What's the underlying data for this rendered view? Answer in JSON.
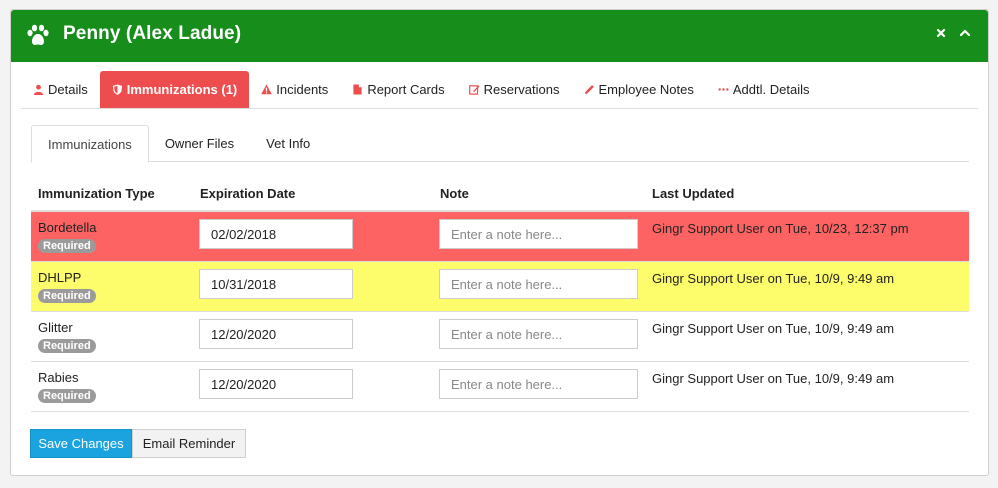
{
  "header": {
    "title": "Penny (Alex Ladue)",
    "paw_icon": "paw-icon",
    "header_bg": "#178d1b"
  },
  "main_tabs": [
    {
      "label": "Details",
      "icon": "user-icon",
      "active": false
    },
    {
      "label": "Immunizations (1)",
      "icon": "shield-icon",
      "active": true
    },
    {
      "label": "Incidents",
      "icon": "warning-icon",
      "active": false
    },
    {
      "label": "Report Cards",
      "icon": "file-icon",
      "active": false
    },
    {
      "label": "Reservations",
      "icon": "edit-icon",
      "active": false
    },
    {
      "label": "Employee Notes",
      "icon": "pencil-icon",
      "active": false
    },
    {
      "label": "Addtl. Details",
      "icon": "ellipsis-icon",
      "active": false
    }
  ],
  "sub_tabs": [
    {
      "label": "Immunizations",
      "active": true
    },
    {
      "label": "Owner Files",
      "active": false
    },
    {
      "label": "Vet Info",
      "active": false
    }
  ],
  "table": {
    "headers": [
      "Immunization Type",
      "Expiration Date",
      "Note",
      "Last Updated"
    ],
    "note_placeholder": "Enter a note here...",
    "rows": [
      {
        "type": "Bordetella",
        "badge": "Required",
        "expiration": "02/02/2018",
        "note": "",
        "last_updated": "Gingr Support User on Tue, 10/23, 12:37 pm",
        "status": "expired"
      },
      {
        "type": "DHLPP",
        "badge": "Required",
        "expiration": "10/31/2018",
        "note": "",
        "last_updated": "Gingr Support User on Tue, 10/9, 9:49 am",
        "status": "expiring"
      },
      {
        "type": "Glitter",
        "badge": "Required",
        "expiration": "12/20/2020",
        "note": "",
        "last_updated": "Gingr Support User on Tue, 10/9, 9:49 am",
        "status": "ok"
      },
      {
        "type": "Rabies",
        "badge": "Required",
        "expiration": "12/20/2020",
        "note": "",
        "last_updated": "Gingr Support User on Tue, 10/9, 9:49 am",
        "status": "ok"
      }
    ]
  },
  "buttons": {
    "save": "Save Changes",
    "email": "Email Reminder"
  },
  "colors": {
    "active_tab": "#ee4d4f",
    "expired_row": "#fd6363",
    "expiring_row": "#fdfc6a",
    "save_button": "#1aa3de"
  }
}
